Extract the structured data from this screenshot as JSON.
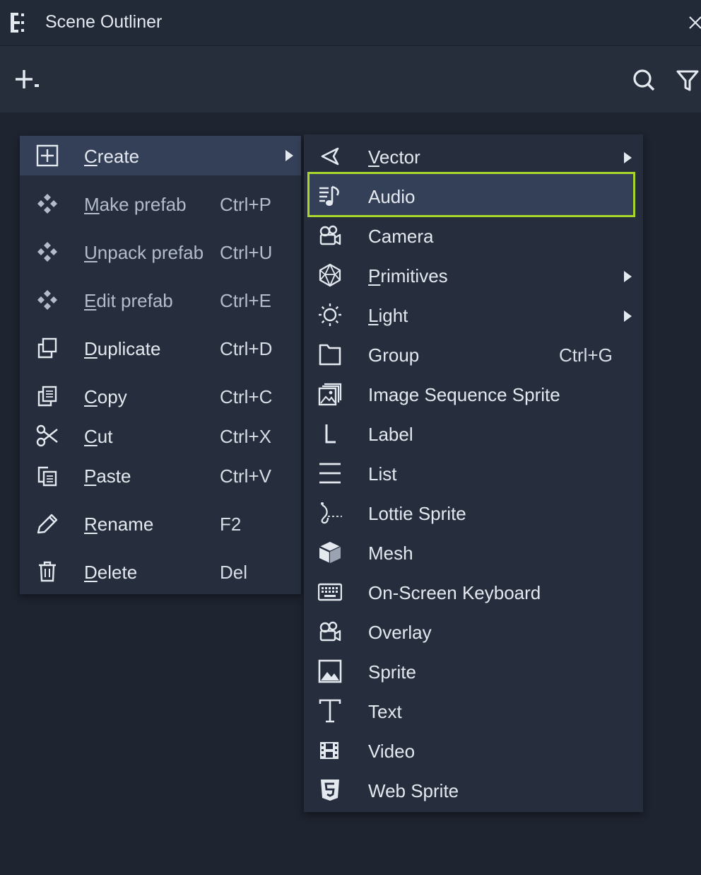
{
  "window": {
    "title": "Scene Outliner",
    "title_icon": "outliner-tree-icon",
    "close_icon": "close-icon"
  },
  "toolbar": {
    "add_icon": "add-dropdown-icon",
    "search_icon": "search-icon",
    "filter_icon": "filter-icon"
  },
  "context_menu": {
    "items": [
      {
        "label": "Create",
        "mnemonic": "C",
        "rest": "reate",
        "shortcut": "",
        "icon": "plus-square-icon",
        "submenu": true,
        "highlighted": true,
        "enabled": true
      },
      {
        "label": "Make prefab",
        "mnemonic": "M",
        "rest": "ake prefab",
        "shortcut": "Ctrl+P",
        "icon": "prefab-icon",
        "submenu": false,
        "enabled": false
      },
      {
        "label": "Unpack prefab",
        "mnemonic": "U",
        "rest": "npack prefab",
        "shortcut": "Ctrl+U",
        "icon": "prefab-icon",
        "submenu": false,
        "enabled": false
      },
      {
        "label": "Edit prefab",
        "mnemonic": "E",
        "rest": "dit prefab",
        "shortcut": "Ctrl+E",
        "icon": "prefab-icon",
        "submenu": false,
        "enabled": false
      },
      {
        "label": "Duplicate",
        "mnemonic": "D",
        "rest": "uplicate",
        "shortcut": "Ctrl+D",
        "icon": "duplicate-icon",
        "submenu": false,
        "enabled": true
      },
      {
        "label": "Copy",
        "mnemonic": "C",
        "rest": "opy",
        "shortcut": "Ctrl+C",
        "icon": "copy-icon",
        "submenu": false,
        "enabled": true
      },
      {
        "label": "Cut",
        "mnemonic": "C",
        "rest": "ut",
        "shortcut": "Ctrl+X",
        "icon": "scissors-icon",
        "submenu": false,
        "enabled": true
      },
      {
        "label": "Paste",
        "mnemonic": "P",
        "rest": "aste",
        "shortcut": "Ctrl+V",
        "icon": "paste-icon",
        "submenu": false,
        "enabled": true
      },
      {
        "label": "Rename",
        "mnemonic": "R",
        "rest": "ename",
        "shortcut": "F2",
        "icon": "pencil-icon",
        "submenu": false,
        "enabled": true
      },
      {
        "label": "Delete",
        "mnemonic": "D",
        "rest": "elete",
        "shortcut": "Del",
        "icon": "trash-icon",
        "submenu": false,
        "enabled": true
      }
    ]
  },
  "create_submenu": {
    "selected": "Audio",
    "items": [
      {
        "label": "Vector",
        "mnemonic": "V",
        "rest": "ector",
        "shortcut": "",
        "icon": "vector-icon",
        "submenu": true
      },
      {
        "label": "Audio",
        "mnemonic": "",
        "rest": "Audio",
        "shortcut": "",
        "icon": "audio-icon",
        "submenu": false
      },
      {
        "label": "Camera",
        "mnemonic": "",
        "rest": "Camera",
        "shortcut": "",
        "icon": "camera-icon",
        "submenu": false
      },
      {
        "label": "Primitives",
        "mnemonic": "P",
        "rest": "rimitives",
        "shortcut": "",
        "icon": "primitives-icon",
        "submenu": true
      },
      {
        "label": "Light",
        "mnemonic": "L",
        "rest": "ight",
        "shortcut": "",
        "icon": "light-icon",
        "submenu": true
      },
      {
        "label": "Group",
        "mnemonic": "",
        "rest": "Group",
        "shortcut": "Ctrl+G",
        "icon": "folder-icon",
        "submenu": false
      },
      {
        "label": "Image Sequence Sprite",
        "mnemonic": "",
        "rest": "Image Sequence Sprite",
        "shortcut": "",
        "icon": "image-sequence-icon",
        "submenu": false
      },
      {
        "label": "Label",
        "mnemonic": "",
        "rest": "Label",
        "shortcut": "",
        "icon": "label-icon",
        "submenu": false
      },
      {
        "label": "List",
        "mnemonic": "",
        "rest": "List",
        "shortcut": "",
        "icon": "list-icon",
        "submenu": false
      },
      {
        "label": "Lottie Sprite",
        "mnemonic": "",
        "rest": "Lottie Sprite",
        "shortcut": "",
        "icon": "lottie-icon",
        "submenu": false
      },
      {
        "label": "Mesh",
        "mnemonic": "",
        "rest": "Mesh",
        "shortcut": "",
        "icon": "mesh-icon",
        "submenu": false
      },
      {
        "label": "On-Screen Keyboard",
        "mnemonic": "",
        "rest": "On-Screen Keyboard",
        "shortcut": "",
        "icon": "keyboard-icon",
        "submenu": false
      },
      {
        "label": "Overlay",
        "mnemonic": "",
        "rest": "Overlay",
        "shortcut": "",
        "icon": "overlay-icon",
        "submenu": false
      },
      {
        "label": "Sprite",
        "mnemonic": "",
        "rest": "Sprite",
        "shortcut": "",
        "icon": "sprite-icon",
        "submenu": false
      },
      {
        "label": "Text",
        "mnemonic": "",
        "rest": "Text",
        "shortcut": "",
        "icon": "text-icon",
        "submenu": false
      },
      {
        "label": "Video",
        "mnemonic": "",
        "rest": "Video",
        "shortcut": "",
        "icon": "video-icon",
        "submenu": false
      },
      {
        "label": "Web Sprite",
        "mnemonic": "",
        "rest": "Web Sprite",
        "shortcut": "",
        "icon": "html5-icon",
        "submenu": false
      }
    ]
  },
  "colors": {
    "background": "#1e2430",
    "panel": "#262e3d",
    "hover": "#344058",
    "highlight_border": "#a9d62a",
    "text": "#e4e8ef",
    "text_disabled": "#b3bccb"
  }
}
